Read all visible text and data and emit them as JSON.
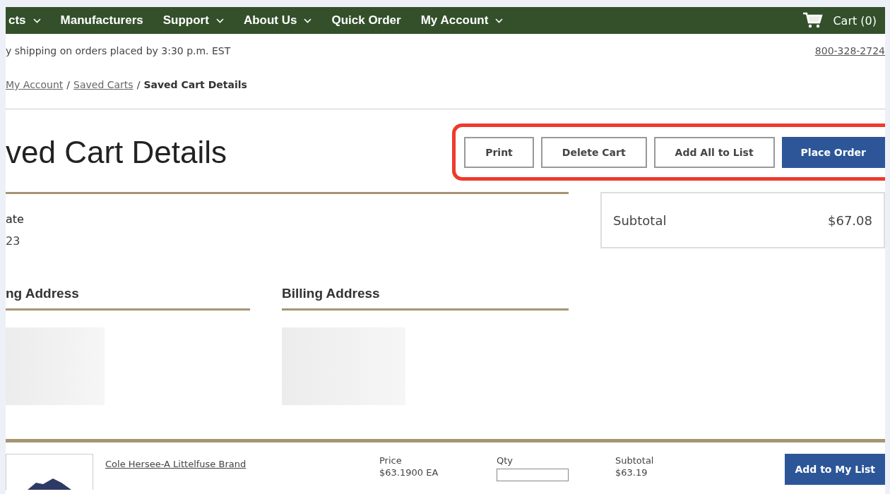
{
  "nav": {
    "items": [
      {
        "label": "cts",
        "dropdown": true
      },
      {
        "label": "Manufacturers",
        "dropdown": false
      },
      {
        "label": "Support",
        "dropdown": true
      },
      {
        "label": "About Us",
        "dropdown": true
      },
      {
        "label": "Quick Order",
        "dropdown": false
      },
      {
        "label": "My Account",
        "dropdown": true
      }
    ],
    "cart": "Cart (0)"
  },
  "info_bar": {
    "shipping": "y shipping on orders placed by 3:30 p.m. EST",
    "phone": "800-328-2724"
  },
  "breadcrumb": [
    {
      "label": "My Account",
      "link": true,
      "separator": "/"
    },
    {
      "label": "Saved Carts",
      "link": true,
      "separator": "/"
    },
    {
      "label": "Saved Cart Details",
      "link": false
    }
  ],
  "title": "ved Cart Details",
  "actions": [
    {
      "label": "Print",
      "primary": false
    },
    {
      "label": "Delete Cart",
      "primary": false
    },
    {
      "label": "Add All to List",
      "primary": false
    },
    {
      "label": "Place Order",
      "primary": true
    }
  ],
  "date": {
    "label": "ate",
    "value": "23"
  },
  "summary": {
    "label": "Subtotal",
    "value": "$67.08"
  },
  "addresses": [
    {
      "heading": "ng Address"
    },
    {
      "heading": "Billing Address"
    }
  ],
  "items": [
    {
      "brand": "Cole Hersee-A Littelfuse Brand",
      "price_label": "Price",
      "price": "$63.1900 EA",
      "qty_label": "Qty",
      "subtotal_label": "Subtotal",
      "subtotal": "$63.19",
      "button": "Add to My List"
    }
  ]
}
